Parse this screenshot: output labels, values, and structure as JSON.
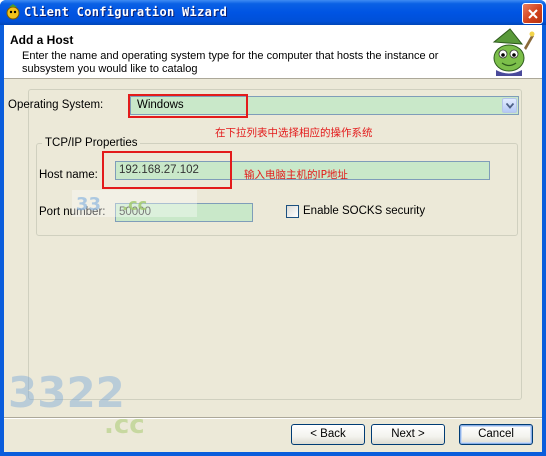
{
  "window": {
    "title": "Client Configuration Wizard",
    "title_icon": "wizard-app-icon",
    "close_icon": "close-icon"
  },
  "header": {
    "title": "Add a Host",
    "description": "Enter the name and operating system type for the computer that hosts the instance or subsystem you would like to catalog",
    "mascot_icon": "wizard-mascot-icon"
  },
  "form": {
    "os_label": "Operating System:",
    "os_value": "Windows",
    "tcp_legend": "TCP/IP Properties",
    "host_label": "Host name:",
    "host_value": "192.168.27.102",
    "port_label": "Port number:",
    "port_value": "50000",
    "socks_label": "Enable SOCKS security",
    "socks_checked": false
  },
  "annotations": {
    "os_note": "在下拉列表中选择相应的操作系统",
    "host_note": "输入电脑主机的IP地址",
    "color": "#e31b1b"
  },
  "buttons": {
    "back": "< Back",
    "next": "Next >",
    "cancel": "Cancel"
  },
  "colors": {
    "titlebar": "#0054e3",
    "dialog_bg": "#ece9d8",
    "field_bg": "#c9e8c9"
  }
}
